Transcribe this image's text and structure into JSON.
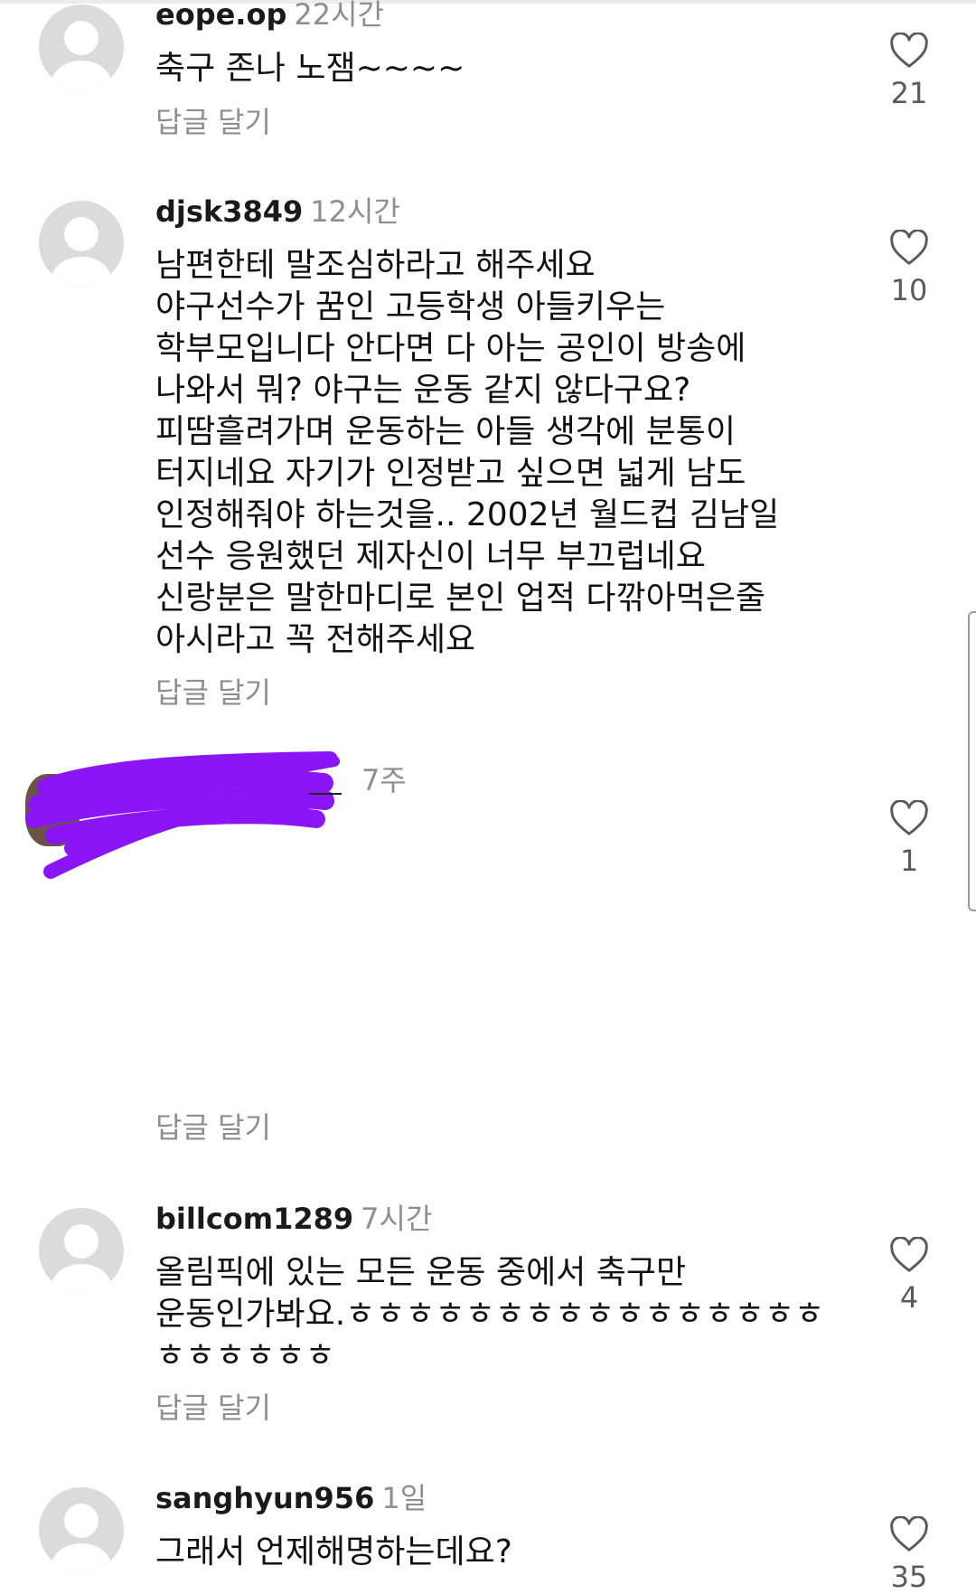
{
  "reply_label": "답글 달기",
  "comments": [
    {
      "username": "eope.op",
      "time": "22시간",
      "text": "축구 존나 노잼~~~~",
      "likes": "21"
    },
    {
      "username": "djsk3849",
      "time": "12시간",
      "text": "남편한테 말조심하라고 해주세요\n야구선수가 꿈인 고등학생 아들키우는\n학부모입니다  안다면 다 아는 공인이 방송에\n나와서 뭐? 야구는 운동 같지 않다구요?\n피땀흘려가며 운동하는 아들 생각에 분통이\n터지네요 자기가 인정받고 싶으면 넓게 남도\n인정해줘야 하는것을.. 2002년 월드컵 김남일\n선수 응원했던 제자신이 너무 부끄럽네요\n신랑분은 말한마디로 본인 업적 다깎아먹은줄\n아시라고 꼭 전해주세요",
      "likes": "10"
    },
    {
      "username": "",
      "time": "7주",
      "text": "",
      "likes": "1"
    },
    {
      "username": "billcom1289",
      "time": "7시간",
      "text": "올림픽에 있는 모든 운동 중에서 축구만\n운동인가봐요.ㅎㅎㅎㅎㅎㅎㅎㅎㅎㅎㅎㅎㅎㅎㅎㅎ\nㅎㅎㅎㅎㅎㅎ",
      "likes": "4"
    },
    {
      "username": "sanghyun956",
      "time": "1일",
      "text": "그래서 언제해명하는데요?",
      "likes": "35"
    }
  ]
}
